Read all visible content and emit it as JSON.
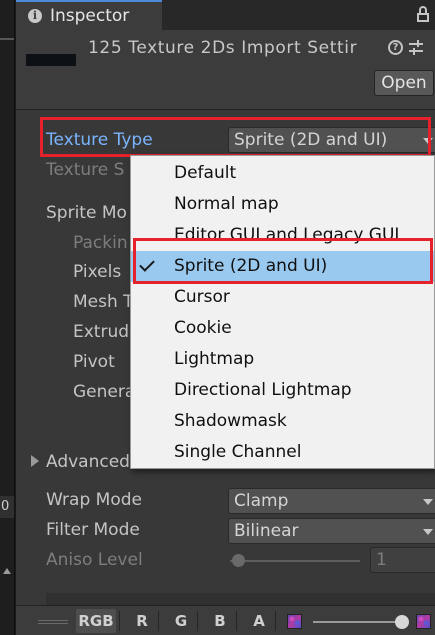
{
  "tab": {
    "title": "Inspector",
    "info_glyph": "i"
  },
  "header": {
    "title": "125 Texture 2Ds Import Settir",
    "help_glyph": "?",
    "open_label": "Open"
  },
  "fields": {
    "texture_type_label": "Texture Type",
    "texture_type_value": "Sprite (2D and UI)",
    "texture_shape_label": "Texture S",
    "sprite_mode_label": "Sprite Mo",
    "packing_label": "Packin",
    "pixels_label": "Pixels",
    "mesh_type_label": "Mesh T",
    "extrude_label": "Extrude",
    "pivot_label": "Pivot",
    "generate_label": "Genera",
    "advanced_label": "Advanced",
    "wrap_mode_label": "Wrap Mode",
    "wrap_mode_value": "Clamp",
    "filter_mode_label": "Filter Mode",
    "filter_mode_value": "Bilinear",
    "aniso_level_label": "Aniso Level",
    "aniso_level_value": "1",
    "aniso_slider_fraction": 0.0
  },
  "dropdown": {
    "options": [
      "Default",
      "Normal map",
      "Editor GUI and Legacy GUI",
      "Sprite (2D and UI)",
      "Cursor",
      "Cookie",
      "Lightmap",
      "Directional Lightmap",
      "Shadowmask",
      "Single Channel"
    ],
    "selected": "Sprite (2D and UI)"
  },
  "bottom_bar": {
    "rgb": "RGB",
    "r": "R",
    "g": "G",
    "b": "B",
    "a": "A",
    "zoom_fraction": 1.0
  },
  "left_strip": {
    "digit": "0"
  },
  "colors": {
    "highlight_red": "#e5212b",
    "selected_item": "#99c9ef",
    "label_blue": "#7ab4ff",
    "panel_bg": "#383838"
  }
}
